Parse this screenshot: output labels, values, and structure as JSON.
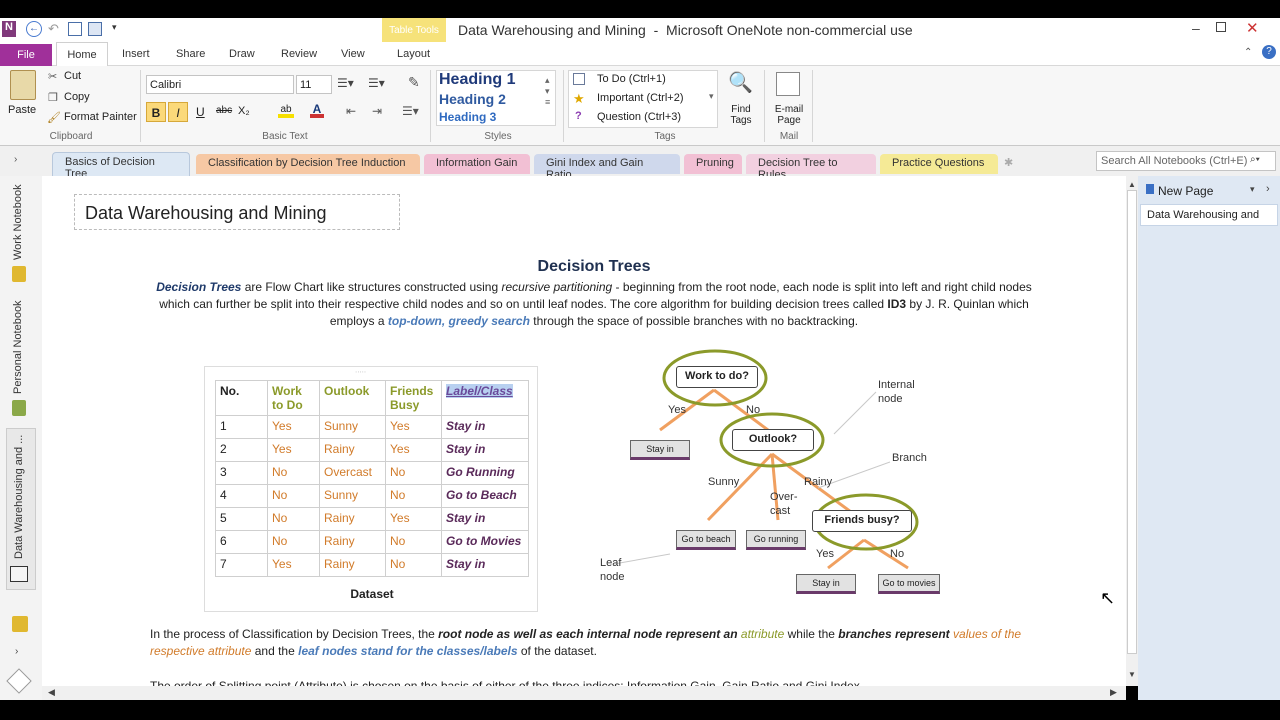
{
  "window": {
    "title": "Data Warehousing and Mining  -  Microsoft OneNote non-commercial use",
    "context_tab": "Table Tools"
  },
  "ribbon_tabs": [
    "File",
    "Home",
    "Insert",
    "Share",
    "Draw",
    "Review",
    "View",
    "Layout"
  ],
  "clipboard": {
    "paste": "Paste",
    "cut": "Cut",
    "copy": "Copy",
    "format_painter": "Format Painter",
    "group": "Clipboard"
  },
  "basic_text": {
    "font": "Calibri",
    "size": "11",
    "group": "Basic Text",
    "bold": "B",
    "italic": "I",
    "underline": "U",
    "strike": "abc",
    "sub": "X₂"
  },
  "styles": {
    "h1": "Heading 1",
    "h2": "Heading 2",
    "h3": "Heading 3",
    "group": "Styles"
  },
  "tags": {
    "todo": "To Do (Ctrl+1)",
    "important": "Important (Ctrl+2)",
    "question": "Question (Ctrl+3)",
    "group": "Tags",
    "find": "Find Tags"
  },
  "mail": {
    "email": "E-mail Page",
    "group": "Mail"
  },
  "sections": [
    "Basics of Decision Tree",
    "Classification by Decision Tree Induction",
    "Information Gain",
    "Gini Index and Gain Ratio",
    "Pruning",
    "Decision Tree to Rules",
    "Practice Questions"
  ],
  "search": {
    "placeholder": "Search All Notebooks (Ctrl+E)"
  },
  "notebooks": [
    "Work Notebook",
    "Personal Notebook",
    "Data Warehousing and ..."
  ],
  "pages_pane": {
    "new_page": "New Page",
    "pages": [
      "Data Warehousing and"
    ]
  },
  "note": {
    "page_title": "Data Warehousing and Mining",
    "heading": "Decision Trees",
    "p1_a": "Decision Trees",
    "p1_b": " are Flow Chart like structures constructed using ",
    "p1_c": "recursive partitioning",
    "p1_d": " - beginning from the root node, each node is split into left and right child nodes which can further be split into their respective child nodes and so on until leaf nodes. The core algorithm for building decision trees called ",
    "p1_e": "ID3",
    "p1_f": " by J. R. Quinlan which employs a ",
    "p1_g": "top-down, greedy search",
    "p1_h": " through the space of possible branches with no backtracking.",
    "table_caption": "Dataset",
    "table_headers": [
      "No.",
      "Work to Do",
      "Outlook",
      "Friends Busy",
      "Label/Class"
    ],
    "table_rows": [
      [
        "1",
        "Yes",
        "Sunny",
        "Yes",
        "Stay in"
      ],
      [
        "2",
        "Yes",
        "Rainy",
        "Yes",
        "Stay in"
      ],
      [
        "3",
        "No",
        "Overcast",
        "No",
        "Go Running"
      ],
      [
        "4",
        "No",
        "Sunny",
        "No",
        "Go to Beach"
      ],
      [
        "5",
        "No",
        "Rainy",
        "Yes",
        "Stay in"
      ],
      [
        "6",
        "No",
        "Rainy",
        "No",
        "Go to Movies"
      ],
      [
        "7",
        "Yes",
        "Rainy",
        "No",
        "Stay in"
      ]
    ],
    "p2_a": "In the process of Classification by Decision Trees, the ",
    "p2_b": "root node as well as each internal node represent an",
    "p2_c": " attribute",
    "p2_d": " while  the ",
    "p2_e": "branches represent",
    "p2_f": " values of the respective attribute",
    "p2_g": " and the ",
    "p2_h": "leaf nodes stand for the classes/labels",
    "p2_i": " of the dataset.",
    "p3": "The order of Splitting point (Attribute) is chosen on the basis of either of the three indices: Information Gain, Gain Ratio and Gini Index"
  },
  "tree": {
    "n_work": "Work to do?",
    "n_outlook": "Outlook?",
    "n_friends": "Friends busy?",
    "l_stay1": "Stay in",
    "l_beach": "Go to beach",
    "l_running": "Go running",
    "l_stay2": "Stay in",
    "l_movies": "Go to movies",
    "e_yes1": "Yes",
    "e_no1": "No",
    "e_sunny": "Sunny",
    "e_over": "Over-\ncast",
    "e_rainy": "Rainy",
    "e_yes2": "Yes",
    "e_no2": "No",
    "a_internal": "Internal\nnode",
    "a_branch": "Branch",
    "a_leaf": "Leaf\nnode"
  },
  "colors": {
    "file_tab": "#a0309a",
    "section_active": "#dde8f4",
    "accent_olive": "#8b9a2a",
    "accent_orange": "#d17b2a"
  }
}
